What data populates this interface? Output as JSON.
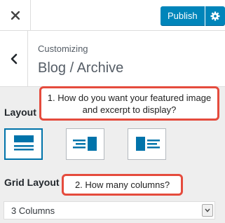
{
  "header": {
    "publish_label": "Publish",
    "close_icon": "close-icon",
    "settings_icon": "gear-icon"
  },
  "section": {
    "breadcrumb": "Customizing",
    "title": "Blog / Archive",
    "back_icon": "chevron-left-icon"
  },
  "layout": {
    "label": "Layout",
    "options": [
      {
        "icon": "layout-image-above-text-icon",
        "selected": true
      },
      {
        "icon": "layout-text-left-image-right-icon",
        "selected": false
      },
      {
        "icon": "layout-image-left-text-right-icon",
        "selected": false
      }
    ]
  },
  "grid_layout": {
    "label": "Grid Layout",
    "selected": "3 Columns",
    "arrow_icon": "chevron-down-icon"
  },
  "annotations": {
    "callout_1": "1. How do you want your featured image and excerpt to display?",
    "callout_2": "2. How many columns?"
  },
  "colors": {
    "accent": "#0085ba",
    "selected_border": "#0073aa",
    "callout_border": "#e54b3d",
    "panel_bg": "#eeeeee"
  }
}
